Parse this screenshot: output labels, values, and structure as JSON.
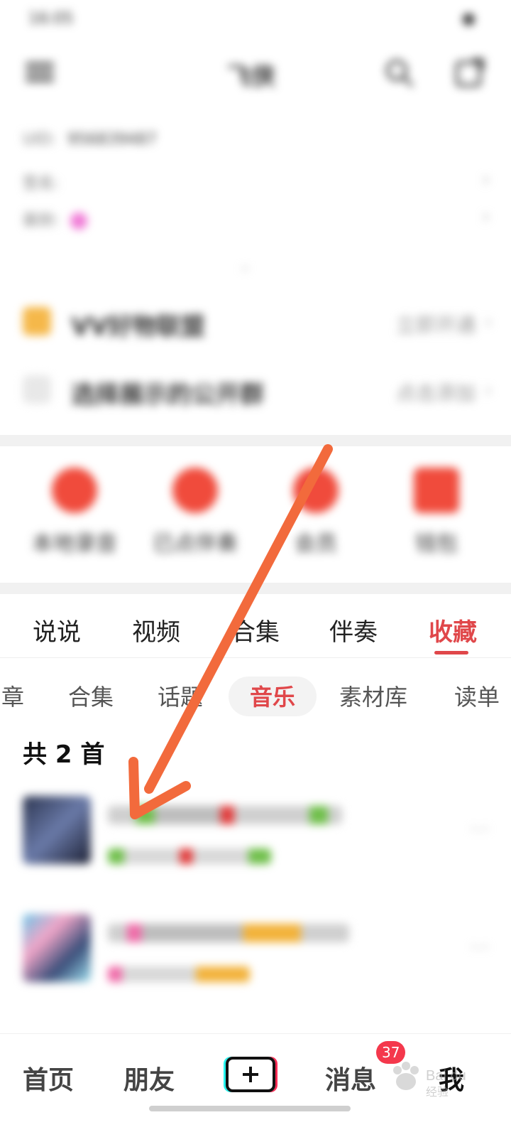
{
  "status_bar": {
    "time": "16:05",
    "battery": "●"
  },
  "header": {
    "title": "飞侠",
    "search_icon": "search-icon",
    "share_icon": "share-icon"
  },
  "profile_info": {
    "rows": [
      {
        "label": "",
        "value": ""
      },
      {
        "label": "UID:",
        "value": "956839487"
      },
      {
        "label": "签名:",
        "value": ""
      },
      {
        "label": "装扮:",
        "value": ""
      }
    ]
  },
  "vip_rows": [
    {
      "label": "VV好物联盟",
      "action": "立即开通"
    },
    {
      "label": "选择展示的公开群",
      "action": "点击添加"
    }
  ],
  "quick_actions": [
    {
      "label": "本地录音",
      "color": "#f04b3c"
    },
    {
      "label": "已点伴奏",
      "color": "#f04b3c"
    },
    {
      "label": "会员",
      "color": "#f04b3c"
    },
    {
      "label": "钱包",
      "color": "#f04b3c"
    }
  ],
  "main_tabs": [
    "说说",
    "视频",
    "合集",
    "伴奏",
    "收藏"
  ],
  "main_tab_active": "收藏",
  "sub_tabs": [
    "章",
    "合集",
    "话题",
    "音乐",
    "素材库",
    "读单"
  ],
  "sub_tab_active": "音乐",
  "count_label": "共 2 首",
  "music_items": [
    {
      "title": "",
      "subtitle": ""
    },
    {
      "title": "",
      "subtitle": ""
    }
  ],
  "bottom_nav": {
    "home": "首页",
    "friends": "朋友",
    "messages": "消息",
    "me": "我",
    "badge": "37"
  },
  "watermark": "Bai du 经验",
  "colors": {
    "accent": "#e0474a",
    "badge": "#f4384c",
    "arrow": "#f26a3c"
  }
}
